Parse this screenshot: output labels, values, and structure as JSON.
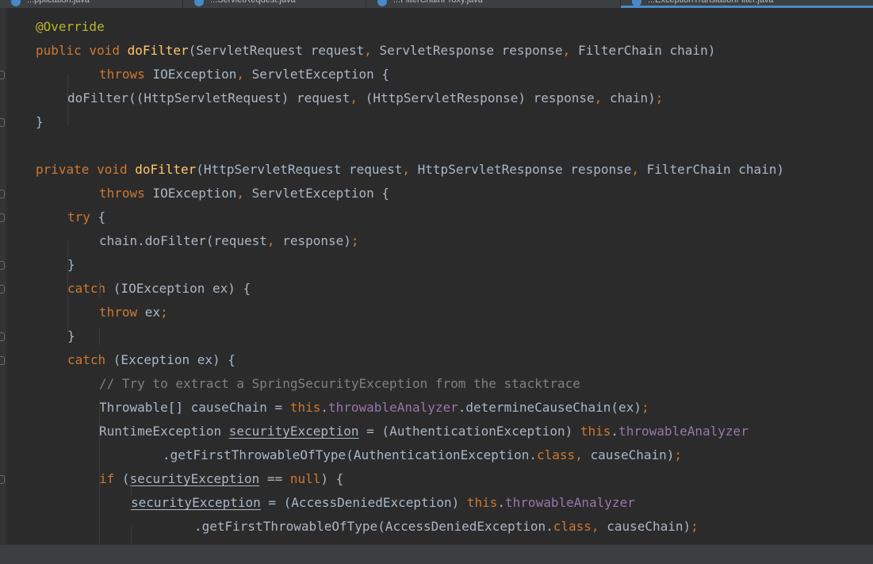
{
  "tabs": [
    {
      "label": "...pplication.java",
      "active": false
    },
    {
      "label": "...ServletRequest.java",
      "active": false
    },
    {
      "label": "...FilterChainProxy.java",
      "active": false
    },
    {
      "label": "...ExceptionTranslationFilter.java",
      "active": true
    }
  ],
  "colors": {
    "background": "#2b2b2b",
    "keyword": "#cc7832",
    "method": "#ffc66d",
    "annotation": "#bbb529",
    "comment": "#808080",
    "field": "#9876aa",
    "text": "#a9b7c6"
  },
  "code": [
    {
      "indent": 0,
      "fold": false,
      "tokens": [
        {
          "t": "ann",
          "v": "@Override"
        }
      ]
    },
    {
      "indent": 0,
      "fold": false,
      "tokens": [
        {
          "t": "kw",
          "v": "public void "
        },
        {
          "t": "fn",
          "v": "doFilter"
        },
        {
          "t": "pl",
          "v": "(ServletRequest request"
        },
        {
          "t": "pu",
          "v": ", "
        },
        {
          "t": "pl",
          "v": "ServletResponse response"
        },
        {
          "t": "pu",
          "v": ", "
        },
        {
          "t": "pl",
          "v": "FilterChain chain)"
        }
      ]
    },
    {
      "indent": 2,
      "fold": true,
      "tokens": [
        {
          "t": "kw",
          "v": "throws "
        },
        {
          "t": "pl",
          "v": "IOException"
        },
        {
          "t": "pu",
          "v": ", "
        },
        {
          "t": "pl",
          "v": "ServletException {"
        }
      ]
    },
    {
      "indent": 1,
      "fold": false,
      "tokens": [
        {
          "t": "pl",
          "v": "doFilter((HttpServletRequest) request"
        },
        {
          "t": "pu",
          "v": ", "
        },
        {
          "t": "pl",
          "v": "(HttpServletResponse) response"
        },
        {
          "t": "pu",
          "v": ", "
        },
        {
          "t": "pl",
          "v": "chain)"
        },
        {
          "t": "pu",
          "v": ";"
        }
      ]
    },
    {
      "indent": 0,
      "fold": true,
      "tokens": [
        {
          "t": "pl",
          "v": "}"
        }
      ]
    },
    {
      "indent": 0,
      "fold": false,
      "tokens": []
    },
    {
      "indent": 0,
      "fold": false,
      "tokens": [
        {
          "t": "kw",
          "v": "private void "
        },
        {
          "t": "fn",
          "v": "doFilter"
        },
        {
          "t": "pl",
          "v": "(HttpServletRequest request"
        },
        {
          "t": "pu",
          "v": ", "
        },
        {
          "t": "pl",
          "v": "HttpServletResponse response"
        },
        {
          "t": "pu",
          "v": ", "
        },
        {
          "t": "pl",
          "v": "FilterChain chain)"
        }
      ]
    },
    {
      "indent": 2,
      "fold": true,
      "tokens": [
        {
          "t": "kw",
          "v": "throws "
        },
        {
          "t": "pl",
          "v": "IOException"
        },
        {
          "t": "pu",
          "v": ", "
        },
        {
          "t": "pl",
          "v": "ServletException {"
        }
      ]
    },
    {
      "indent": 1,
      "fold": true,
      "tokens": [
        {
          "t": "kw",
          "v": "try "
        },
        {
          "t": "pl",
          "v": "{"
        }
      ]
    },
    {
      "indent": 2,
      "fold": false,
      "tokens": [
        {
          "t": "pl",
          "v": "chain.doFilter(request"
        },
        {
          "t": "pu",
          "v": ", "
        },
        {
          "t": "pl",
          "v": "response)"
        },
        {
          "t": "pu",
          "v": ";"
        }
      ]
    },
    {
      "indent": 1,
      "fold": true,
      "tokens": [
        {
          "t": "pl",
          "v": "}"
        }
      ]
    },
    {
      "indent": 1,
      "fold": true,
      "tokens": [
        {
          "t": "kw",
          "v": "catch "
        },
        {
          "t": "pl",
          "v": "(IOException ex) {"
        }
      ]
    },
    {
      "indent": 2,
      "fold": false,
      "tokens": [
        {
          "t": "kw",
          "v": "throw "
        },
        {
          "t": "pl",
          "v": "ex"
        },
        {
          "t": "pu",
          "v": ";"
        }
      ]
    },
    {
      "indent": 1,
      "fold": true,
      "tokens": [
        {
          "t": "pl",
          "v": "}"
        }
      ]
    },
    {
      "indent": 1,
      "fold": true,
      "tokens": [
        {
          "t": "kw",
          "v": "catch "
        },
        {
          "t": "pl",
          "v": "(Exception ex) {"
        }
      ]
    },
    {
      "indent": 2,
      "fold": false,
      "tokens": [
        {
          "t": "cm",
          "v": "// Try to extract a SpringSecurityException from the stacktrace"
        }
      ]
    },
    {
      "indent": 2,
      "fold": false,
      "tokens": [
        {
          "t": "pl",
          "v": "Throwable[] causeChain = "
        },
        {
          "t": "kw",
          "v": "this"
        },
        {
          "t": "pl",
          "v": "."
        },
        {
          "t": "fld",
          "v": "throwableAnalyzer"
        },
        {
          "t": "pl",
          "v": ".determineCauseChain(ex)"
        },
        {
          "t": "pu",
          "v": ";"
        }
      ]
    },
    {
      "indent": 2,
      "fold": false,
      "tokens": [
        {
          "t": "pl",
          "v": "RuntimeException "
        },
        {
          "t": "var",
          "v": "securityException"
        },
        {
          "t": "pl",
          "v": " = (AuthenticationException) "
        },
        {
          "t": "kw",
          "v": "this"
        },
        {
          "t": "pl",
          "v": "."
        },
        {
          "t": "fld",
          "v": "throwableAnalyzer"
        }
      ]
    },
    {
      "indent": 4,
      "fold": false,
      "tokens": [
        {
          "t": "pl",
          "v": ".getFirstThrowableOfType(AuthenticationException."
        },
        {
          "t": "kw",
          "v": "class"
        },
        {
          "t": "pu",
          "v": ", "
        },
        {
          "t": "pl",
          "v": "causeChain)"
        },
        {
          "t": "pu",
          "v": ";"
        }
      ]
    },
    {
      "indent": 2,
      "fold": true,
      "tokens": [
        {
          "t": "kw",
          "v": "if "
        },
        {
          "t": "pl",
          "v": "("
        },
        {
          "t": "var",
          "v": "securityException"
        },
        {
          "t": "pl",
          "v": " == "
        },
        {
          "t": "kw",
          "v": "null"
        },
        {
          "t": "pl",
          "v": ") {"
        }
      ]
    },
    {
      "indent": 3,
      "fold": false,
      "tokens": [
        {
          "t": "var",
          "v": "securityException"
        },
        {
          "t": "pl",
          "v": " = (AccessDeniedException) "
        },
        {
          "t": "kw",
          "v": "this"
        },
        {
          "t": "pl",
          "v": "."
        },
        {
          "t": "fld",
          "v": "throwableAnalyzer"
        }
      ]
    },
    {
      "indent": 5,
      "fold": false,
      "tokens": [
        {
          "t": "pl",
          "v": ".getFirstThrowableOfType(AccessDeniedException."
        },
        {
          "t": "kw",
          "v": "class"
        },
        {
          "t": "pu",
          "v": ", "
        },
        {
          "t": "pl",
          "v": "causeChain)"
        },
        {
          "t": "pu",
          "v": ";"
        }
      ]
    }
  ]
}
